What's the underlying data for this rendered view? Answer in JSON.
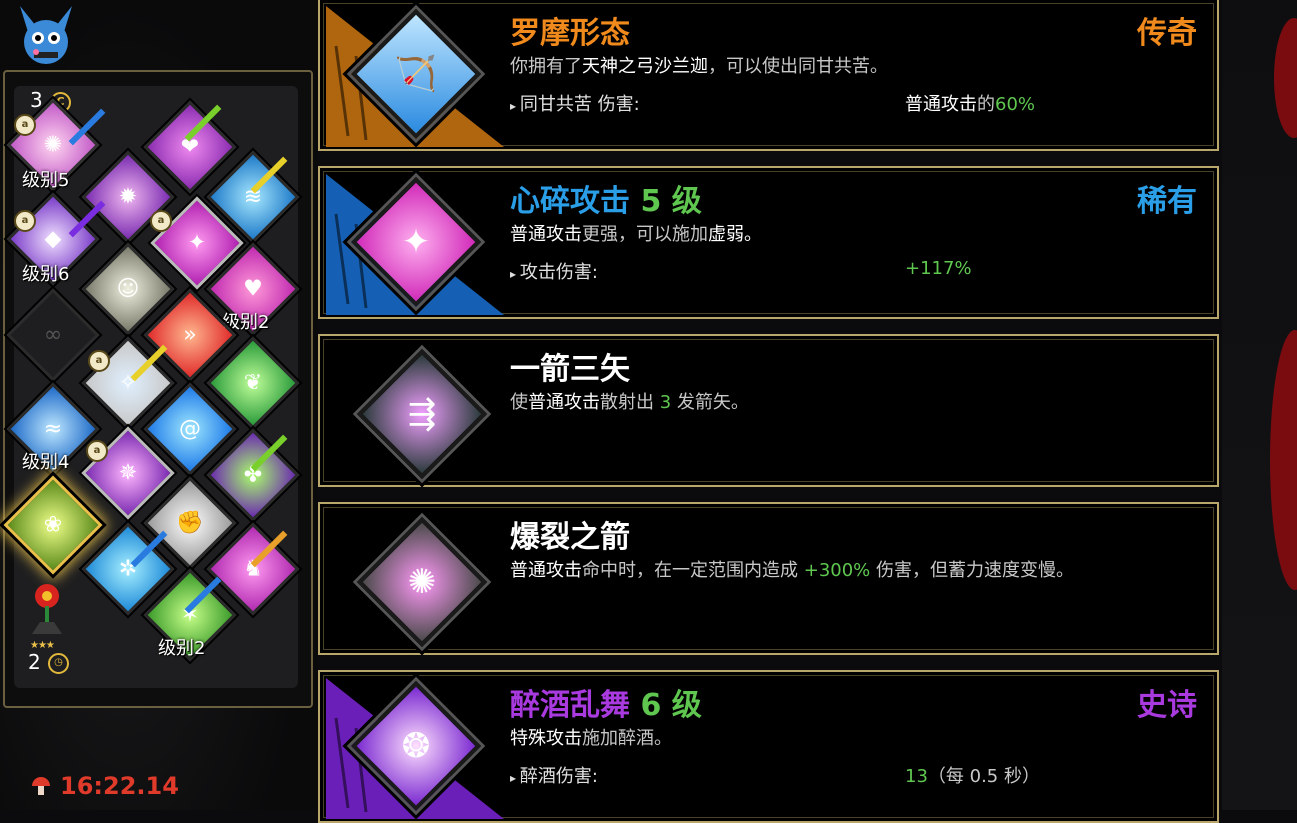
{
  "player": {
    "avatar_icon": "bat-character-icon",
    "stars": "★★★★★",
    "hammer_count": "3",
    "coin_icon": "coin-icon",
    "secondary_stars": "★★★",
    "secondary_count": "2",
    "secondary_icon": "flower-character-icon",
    "timer": "16:22.14"
  },
  "grid_labels": {
    "lvl5": "级别5",
    "lvl6": "级别6",
    "lvl2a": "级别2",
    "lvl4": "级别4",
    "lvl2b": "级别2"
  },
  "cards": [
    {
      "title": "罗摩形态",
      "level_suffix": "",
      "rarity": "传奇",
      "rarity_color": "#f08a1c",
      "title_color": "#f08a1c",
      "tri_color": "#b0660e",
      "icon": "bow-weapon-icon",
      "desc_pre": "你拥有了",
      "desc_hl": "天神之弓沙兰迦",
      "desc_post": "，可以使出同甘共苦。",
      "stat_label": "同甘共苦 伤害:",
      "stat_val_pre": "普通攻击",
      "stat_val_mid": "的",
      "stat_val_num": "60%"
    },
    {
      "title": "心碎攻击",
      "level_suffix": " 5 级",
      "rarity": "稀有",
      "rarity_color": "#2a9fe8",
      "title_color": "#2a9fe8",
      "tri_color": "#1560b4",
      "icon": "heartbreak-icon",
      "desc_pre": "普通攻击",
      "desc_hl": "更强，可以施加",
      "desc_post": "虚弱。",
      "stat_label": "攻击伤害:",
      "stat_val_num": "+117%"
    },
    {
      "title": "一箭三矢",
      "rarity": "",
      "title_color": "#ffffff",
      "icon": "triple-arrow-icon",
      "desc_pre": "使",
      "desc_hl": "普通攻击",
      "desc_mid": "散射出 ",
      "desc_num": "3",
      "desc_post": " 发箭矢。"
    },
    {
      "title": "爆裂之箭",
      "rarity": "",
      "title_color": "#ffffff",
      "icon": "explosive-arrow-icon",
      "desc_pre": "普通攻击",
      "desc_mid": "命中时，在一定范围内造成 ",
      "desc_num": "+300%",
      "desc_post": " 伤害，但蓄力速度变慢。"
    },
    {
      "title": "醉酒乱舞",
      "level_suffix": " 6 级",
      "rarity": "史诗",
      "rarity_color": "#a93ae0",
      "title_color": "#a93ae0",
      "tri_color": "#6a1fb8",
      "icon": "drunk-dance-icon",
      "desc_pre": "特殊攻击",
      "desc_post": "施加醉酒。",
      "stat_label": "醉酒伤害:",
      "stat_val_num": "13",
      "stat_val_post": "（每 0.5 秒）"
    }
  ]
}
